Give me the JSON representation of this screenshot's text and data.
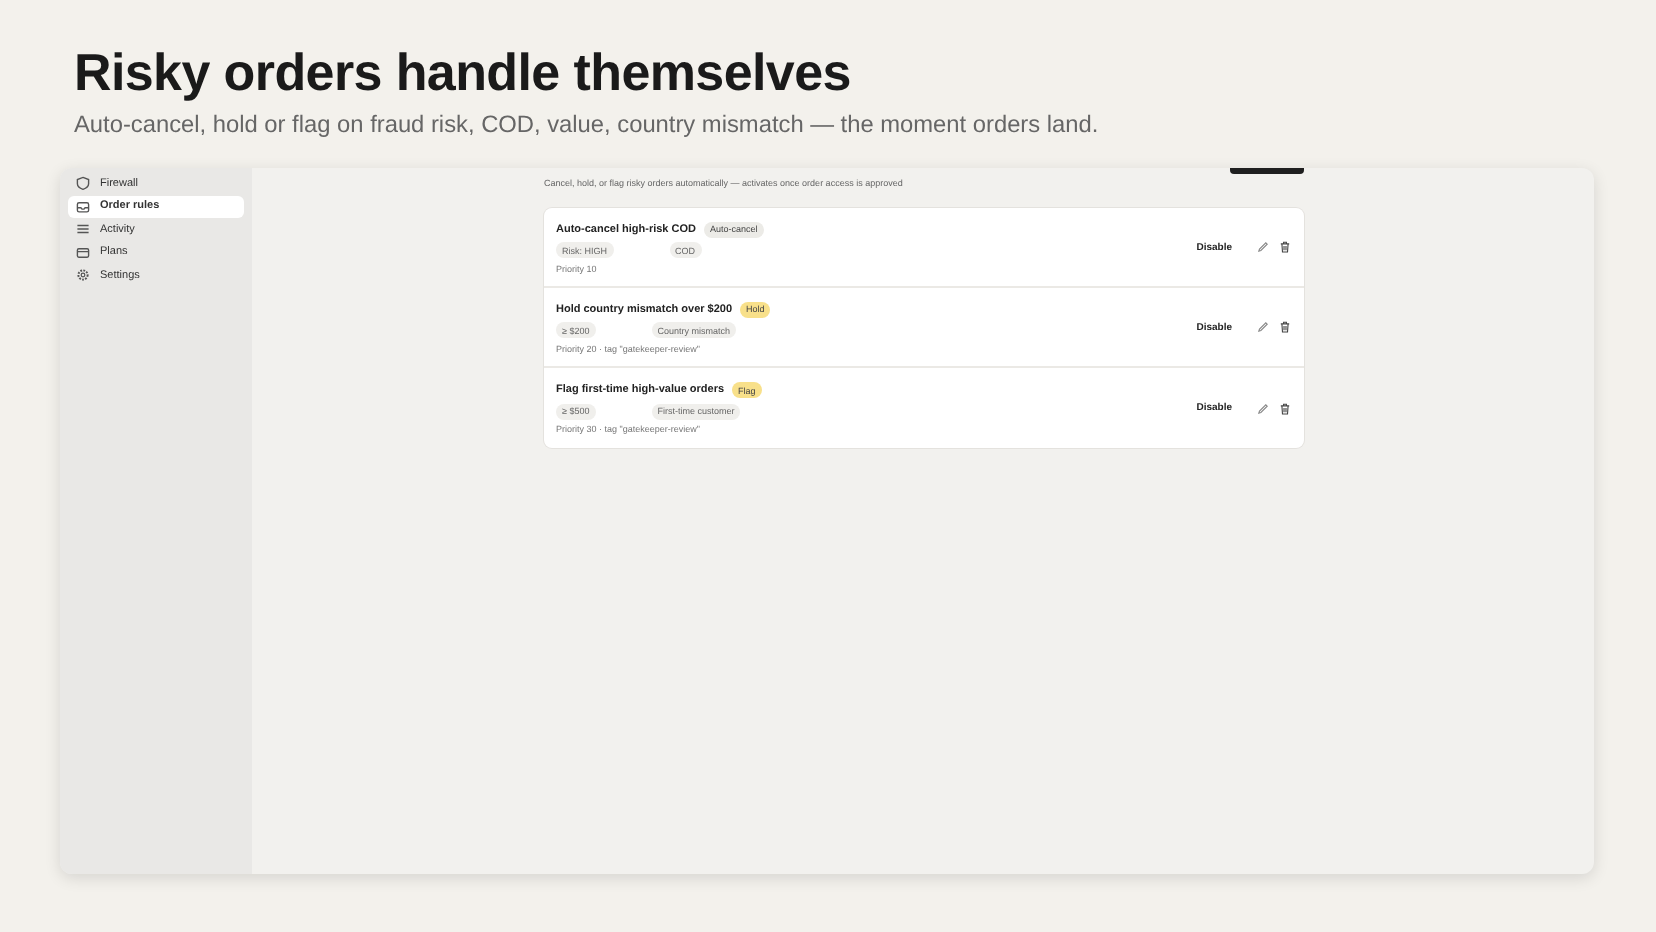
{
  "headline": "Risky orders handle themselves",
  "subheadline": "Auto-cancel, hold or flag on fraud risk, COD, value, country mismatch — the moment orders land.",
  "sidebar": {
    "items": [
      {
        "label": "Firewall",
        "selected": false
      },
      {
        "label": "Order rules",
        "selected": true
      },
      {
        "label": "Activity",
        "selected": false
      },
      {
        "label": "Plans",
        "selected": false
      },
      {
        "label": "Settings",
        "selected": false
      }
    ]
  },
  "page": {
    "description": "Cancel, hold, or flag risky orders automatically — activates once order access is approved"
  },
  "rules": [
    {
      "name": "Auto-cancel high-risk COD",
      "action": {
        "label": "Auto-cancel",
        "color": "#ecebe7"
      },
      "conditions": [
        "Risk: HIGH",
        "COD"
      ],
      "meta": "Priority 10",
      "toggle": "Disable"
    },
    {
      "name": "Hold country mismatch over $200",
      "action": {
        "label": "Hold",
        "color": "#f8e08a"
      },
      "conditions": [
        "≥ $200",
        "Country mismatch"
      ],
      "meta": "Priority 20 · tag \"gatekeeper-review\"",
      "toggle": "Disable"
    },
    {
      "name": "Flag first-time high-value orders",
      "action": {
        "label": "Flag",
        "color": "#f8e08a"
      },
      "conditions": [
        "≥ $500",
        "First-time customer"
      ],
      "meta": "Priority 30 · tag \"gatekeeper-review\"",
      "toggle": "Disable"
    }
  ]
}
